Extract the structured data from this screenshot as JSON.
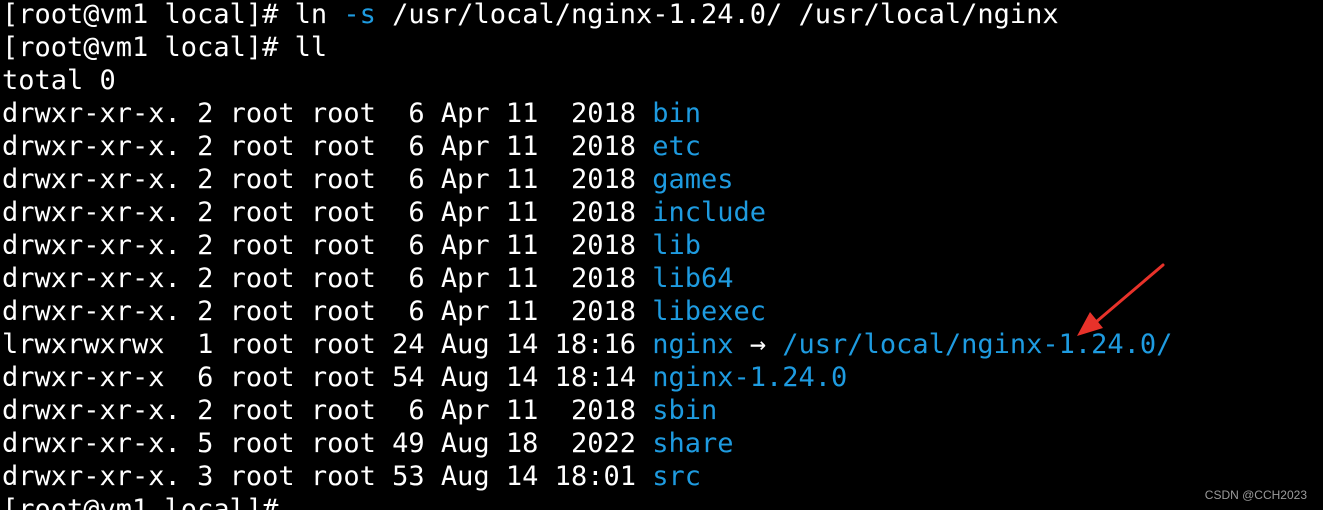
{
  "terminal": {
    "cmd1": {
      "prompt": "[root@vm1 local]# ",
      "command": "ln ",
      "option": "-s",
      "args": " /usr/local/nginx-1.24.0/ /usr/local/nginx"
    },
    "cmd2": {
      "prompt": "[root@vm1 local]# ",
      "command": "ll"
    },
    "total": "total 0",
    "entries": [
      {
        "meta": "drwxr-xr-x. 2 root root  6 Apr 11  2018 ",
        "name": "bin"
      },
      {
        "meta": "drwxr-xr-x. 2 root root  6 Apr 11  2018 ",
        "name": "etc"
      },
      {
        "meta": "drwxr-xr-x. 2 root root  6 Apr 11  2018 ",
        "name": "games"
      },
      {
        "meta": "drwxr-xr-x. 2 root root  6 Apr 11  2018 ",
        "name": "include"
      },
      {
        "meta": "drwxr-xr-x. 2 root root  6 Apr 11  2018 ",
        "name": "lib"
      },
      {
        "meta": "drwxr-xr-x. 2 root root  6 Apr 11  2018 ",
        "name": "lib64"
      },
      {
        "meta": "drwxr-xr-x. 2 root root  6 Apr 11  2018 ",
        "name": "libexec"
      },
      {
        "meta": "lrwxrwxrwx  1 root root 24 Aug 14 18:16 ",
        "name": "nginx",
        "arrow": " → ",
        "target": "/usr/local/nginx-1.24.0/"
      },
      {
        "meta": "drwxr-xr-x  6 root root 54 Aug 14 18:14 ",
        "name": "nginx-1.24.0"
      },
      {
        "meta": "drwxr-xr-x. 2 root root  6 Apr 11  2018 ",
        "name": "sbin"
      },
      {
        "meta": "drwxr-xr-x. 5 root root 49 Aug 18  2022 ",
        "name": "share"
      },
      {
        "meta": "drwxr-xr-x. 3 root root 53 Aug 14 18:01 ",
        "name": "src"
      }
    ],
    "cmd3": {
      "prompt": "[root@vm1 local]#"
    }
  },
  "watermark": "CSDN @CCH2023",
  "colors": {
    "background": "#000000",
    "text": "#ffffff",
    "directory": "#1e9be0",
    "annotation_arrow": "#e8322a"
  }
}
